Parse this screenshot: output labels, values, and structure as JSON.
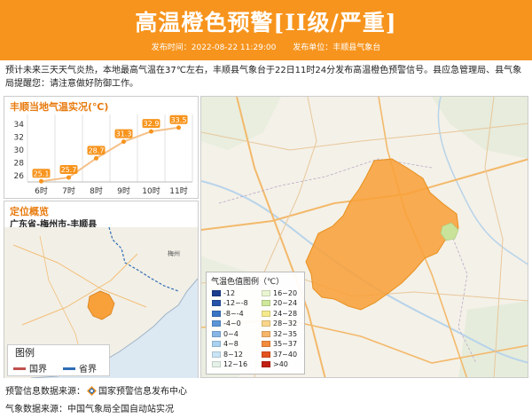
{
  "header": {
    "title": "高温橙色预警[II级/严重]",
    "publish_time": "发布时间：2022-08-22 11:29:00",
    "publisher": "发布单位：丰顺县气象台"
  },
  "description": "预计未来三天天气炎热，本地最高气温在37℃左右，丰顺县气象台于22日11时24分发布高温橙色预警信号。县应急管理局、县气象局提醒您：请注意做好防御工作。",
  "chart_panel": {
    "title": "丰顺当地气温实况(℃)"
  },
  "chart_data": {
    "type": "line",
    "title": "丰顺当地气温实况(℃)",
    "categories": [
      "6时",
      "7时",
      "8时",
      "9时",
      "10时",
      "11时"
    ],
    "series": [
      {
        "values": [
          25.1,
          25.7,
          28.7,
          31.3,
          32.9,
          33.5
        ]
      }
    ],
    "y_ticks": [
      "34",
      "32",
      "30",
      "28",
      "26"
    ],
    "ylim": [
      25,
      35
    ],
    "grid": true
  },
  "location": {
    "title": "定位概览",
    "path": "广东省-梅州市-丰顺县",
    "map_labels": {
      "meizhou": "梅州"
    }
  },
  "mini_legend": {
    "title": "图例",
    "items": [
      {
        "label": "国界",
        "color": "#c0504d"
      },
      {
        "label": "省界",
        "color": "#2e6db4"
      }
    ]
  },
  "temp_legend": {
    "title": "气温色值图例（℃）",
    "items": [
      {
        "label": "-12",
        "color": "#1a3d8f"
      },
      {
        "label": "-12~-8",
        "color": "#2553a8"
      },
      {
        "label": "-8~-4",
        "color": "#3a74c4"
      },
      {
        "label": "-4~0",
        "color": "#5b95d6"
      },
      {
        "label": "0~4",
        "color": "#86b6e6"
      },
      {
        "label": "4~8",
        "color": "#a9d0ef"
      },
      {
        "label": "8~12",
        "color": "#c9e4f4"
      },
      {
        "label": "12~16",
        "color": "#e4f2e8"
      },
      {
        "label": "16~20",
        "color": "#eaf5d2"
      },
      {
        "label": "20~24",
        "color": "#cfe89a"
      },
      {
        "label": "24~28",
        "color": "#f6e98c"
      },
      {
        "label": "28~32",
        "color": "#f9d68a"
      },
      {
        "label": "32~35",
        "color": "#f6b66a"
      },
      {
        "label": "35~37",
        "color": "#f38b3c"
      },
      {
        "label": "37~40",
        "color": "#e3531f"
      },
      {
        "label": ">40",
        "color": "#c21f14"
      }
    ]
  },
  "footer": {
    "warning_source_label": "预警信息数据来源：",
    "warning_source_value": "国家预警信息发布中心",
    "weather_source_label": "气象数据来源：",
    "weather_source_value": "中国气象局全国自动站实况"
  },
  "colors": {
    "header_bg": "#f7941d",
    "accent_orange": "#e87b0f",
    "line_color": "#f5c088",
    "point_color": "#f7941d",
    "warning_area": "#f8a13a"
  }
}
